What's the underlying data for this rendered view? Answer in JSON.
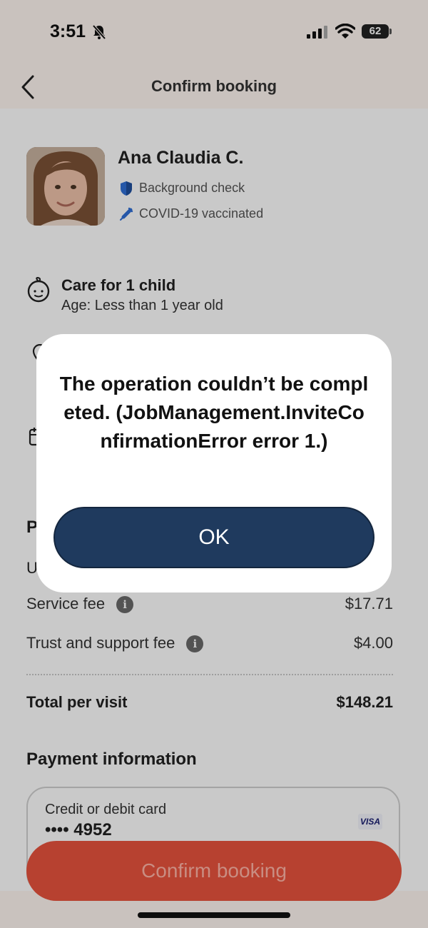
{
  "status_bar": {
    "time": "3:51",
    "battery": "62"
  },
  "nav": {
    "title": "Confirm booking"
  },
  "caregiver": {
    "name": "Ana Claudia C.",
    "badges": [
      "Background check",
      "COVID-19 vaccinated"
    ]
  },
  "care": {
    "title": "Care for 1 child",
    "age": "Age: Less than 1 year old"
  },
  "partial": {
    "section_letter": "P",
    "row_letter": "U"
  },
  "fees": [
    {
      "label": "Service fee",
      "amount": "$17.71"
    },
    {
      "label": "Trust and support fee",
      "amount": "$4.00"
    }
  ],
  "total": {
    "label": "Total per visit",
    "amount": "$148.21"
  },
  "payment": {
    "heading": "Payment information",
    "card_label": "Credit or debit card",
    "card_number": "•••• 4952",
    "card_brand": "VISA"
  },
  "confirm_button": "Confirm booking",
  "alert": {
    "message": "The operation couldn’t be completed. (JobManagement.InviteConfirmationError error 1.)",
    "ok_label": "OK"
  },
  "colors": {
    "primary_button": "#e8533e",
    "alert_button": "#1f3a5e",
    "header_bg": "#fff6f1",
    "badge_icon": "#2f6fd6"
  }
}
